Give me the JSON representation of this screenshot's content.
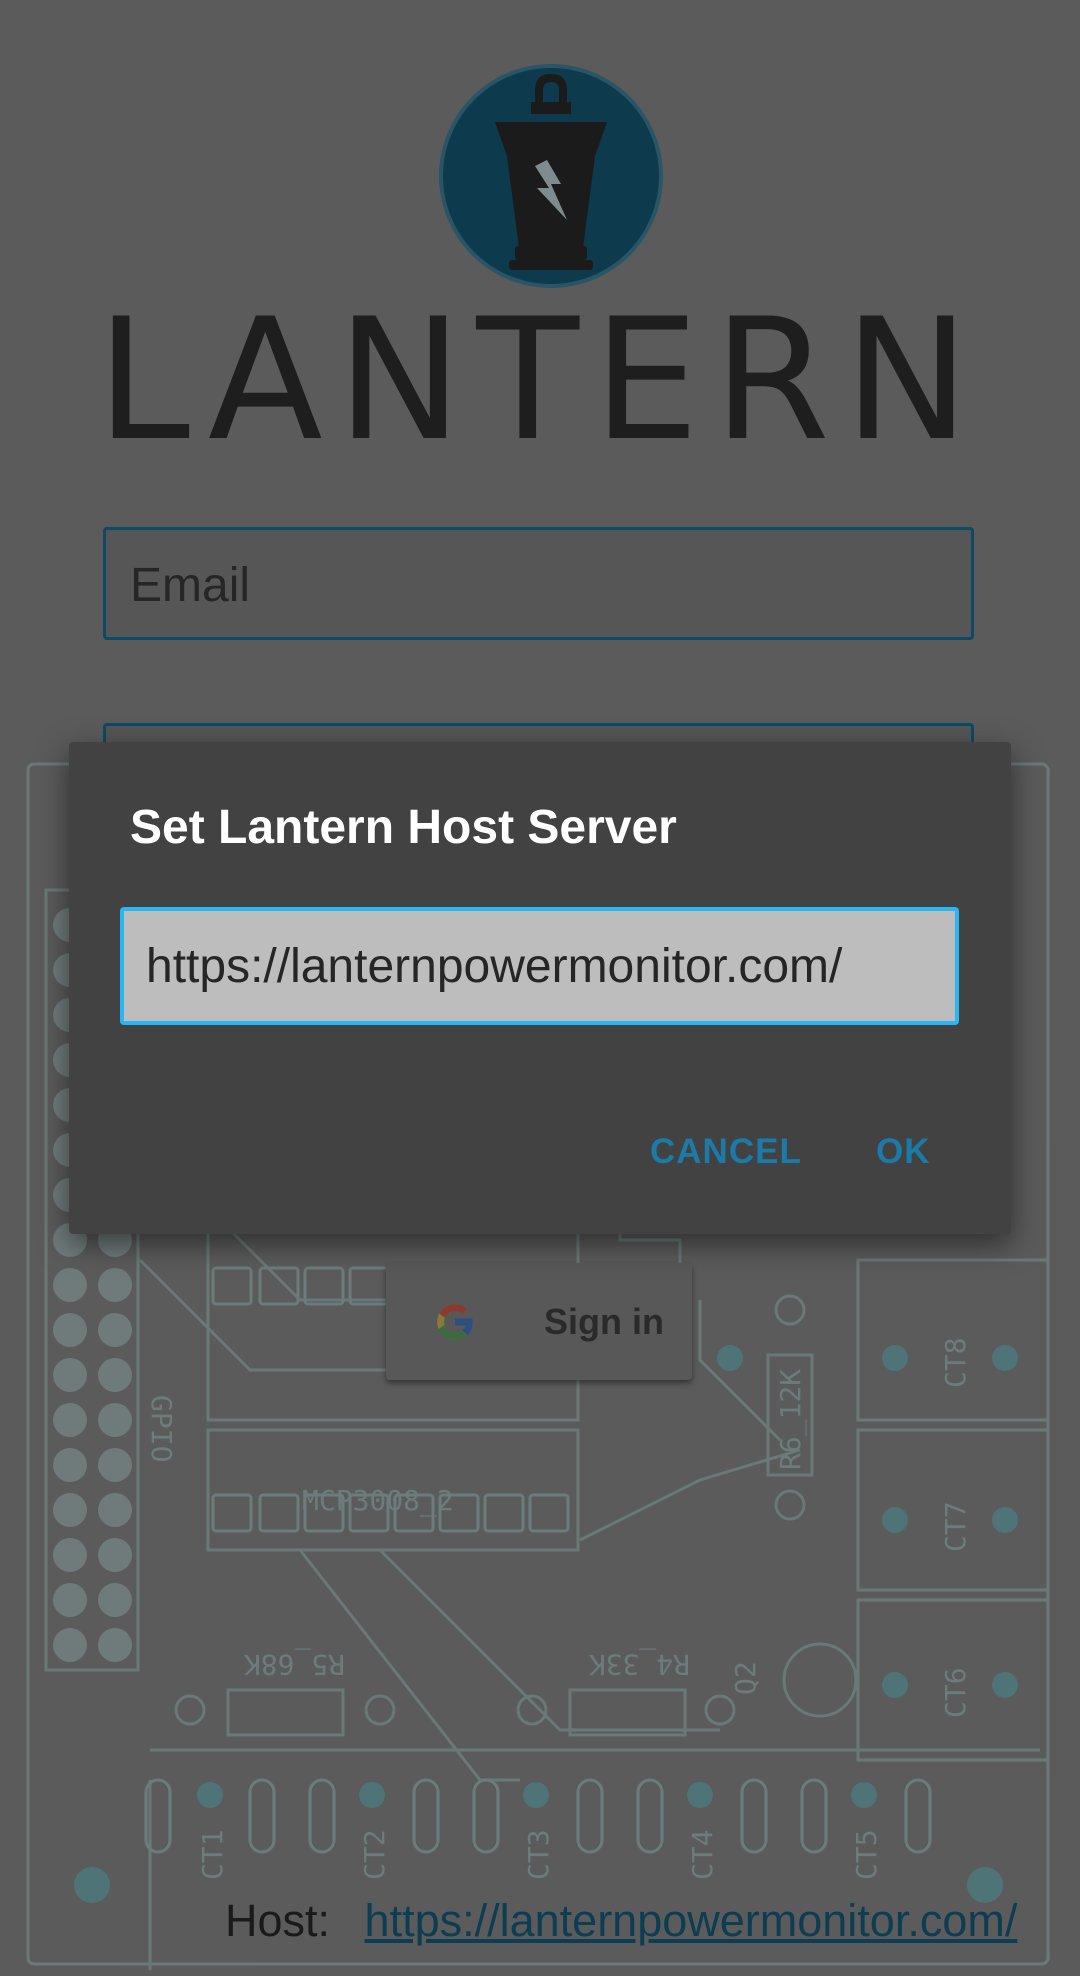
{
  "app": {
    "brand": "LANTERN"
  },
  "login": {
    "email_placeholder": "Email",
    "google_button_label": "Sign in"
  },
  "footer": {
    "host_label": "Host:",
    "host_url": "https://lanternpowermonitor.com/"
  },
  "dialog": {
    "title": "Set Lantern Host Server",
    "input_value": "https://lanternpowermonitor.com/",
    "cancel_label": "CANCEL",
    "ok_label": "OK"
  },
  "pcb_labels": {
    "gpio": "GPIO",
    "chip": "MCP3008_2",
    "r6": "R6_12K",
    "r5": "R5_68K",
    "r4": "R4_33K",
    "q2": "Q2",
    "ct": [
      "CT1",
      "CT2",
      "CT3",
      "CT4",
      "CT5",
      "CT6",
      "CT7",
      "CT8"
    ]
  },
  "colors": {
    "accent": "#29b6f6",
    "button_text": "#1a7aa8",
    "dialog_bg": "#424242",
    "scrim_bg": "#5b5b5b"
  },
  "icons": {
    "logo": "lantern-logo-icon",
    "google": "google-g-icon"
  }
}
